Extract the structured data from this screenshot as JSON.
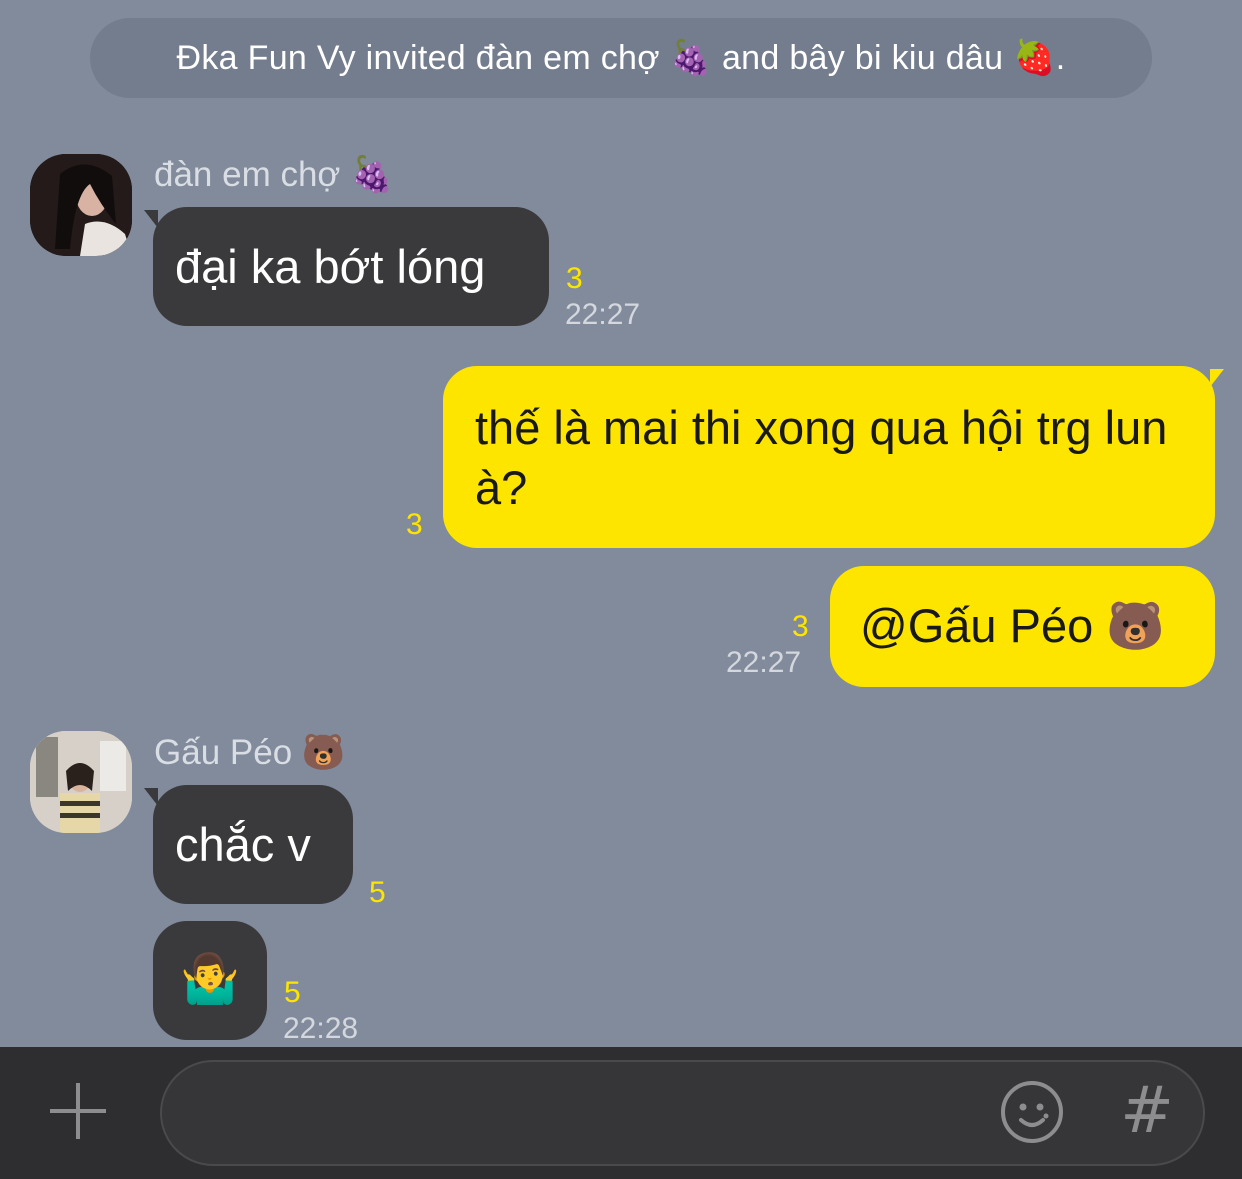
{
  "system_notice": "Đka Fun Vy invited đàn em chợ 🍇 and bây bi kiu dâu 🍓.",
  "messages": [
    {
      "sender": "đàn em chợ 🍇",
      "text": "đại ka bớt lóng",
      "unread": "3",
      "time": "22:27"
    },
    {
      "text": "thế là mai thi xong qua hội trg lun à?",
      "unread": "3"
    },
    {
      "text": "@Gấu Péo 🐻",
      "unread": "3",
      "time": "22:27"
    },
    {
      "sender": "Gấu Péo 🐻",
      "text": "chắc v",
      "unread": "5"
    },
    {
      "text": "🤷‍♂️",
      "unread": "5",
      "time": "22:28"
    }
  ],
  "input": {
    "placeholder": "",
    "hash_label": "#"
  },
  "icons": {
    "plus": "plus-icon",
    "emoji": "emoji-icon",
    "hash": "hash-icon"
  },
  "colors": {
    "background": "#818b9c",
    "incoming_bubble": "#3a3a3c",
    "outgoing_bubble": "#fee500",
    "unread": "#fee500"
  }
}
